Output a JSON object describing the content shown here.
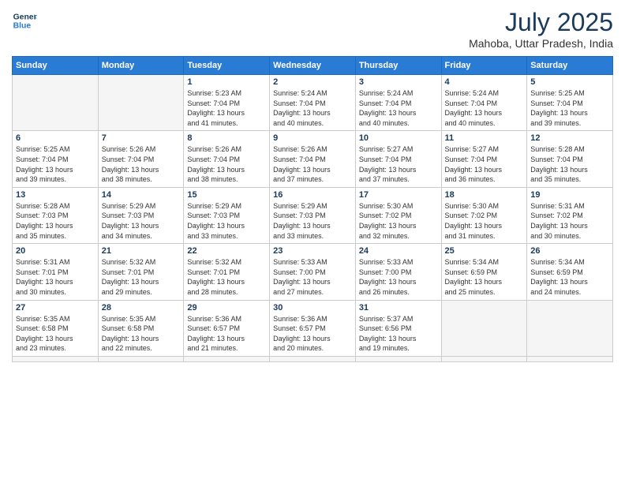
{
  "logo": {
    "line1": "General",
    "line2": "Blue"
  },
  "title": {
    "month_year": "July 2025",
    "location": "Mahoba, Uttar Pradesh, India"
  },
  "weekdays": [
    "Sunday",
    "Monday",
    "Tuesday",
    "Wednesday",
    "Thursday",
    "Friday",
    "Saturday"
  ],
  "days": [
    {
      "num": "",
      "sunrise": "",
      "sunset": "",
      "daylight": ""
    },
    {
      "num": "",
      "sunrise": "",
      "sunset": "",
      "daylight": ""
    },
    {
      "num": "1",
      "sunrise": "Sunrise: 5:23 AM",
      "sunset": "Sunset: 7:04 PM",
      "daylight": "Daylight: 13 hours and 41 minutes."
    },
    {
      "num": "2",
      "sunrise": "Sunrise: 5:24 AM",
      "sunset": "Sunset: 7:04 PM",
      "daylight": "Daylight: 13 hours and 40 minutes."
    },
    {
      "num": "3",
      "sunrise": "Sunrise: 5:24 AM",
      "sunset": "Sunset: 7:04 PM",
      "daylight": "Daylight: 13 hours and 40 minutes."
    },
    {
      "num": "4",
      "sunrise": "Sunrise: 5:24 AM",
      "sunset": "Sunset: 7:04 PM",
      "daylight": "Daylight: 13 hours and 40 minutes."
    },
    {
      "num": "5",
      "sunrise": "Sunrise: 5:25 AM",
      "sunset": "Sunset: 7:04 PM",
      "daylight": "Daylight: 13 hours and 39 minutes."
    },
    {
      "num": "6",
      "sunrise": "Sunrise: 5:25 AM",
      "sunset": "Sunset: 7:04 PM",
      "daylight": "Daylight: 13 hours and 39 minutes."
    },
    {
      "num": "7",
      "sunrise": "Sunrise: 5:26 AM",
      "sunset": "Sunset: 7:04 PM",
      "daylight": "Daylight: 13 hours and 38 minutes."
    },
    {
      "num": "8",
      "sunrise": "Sunrise: 5:26 AM",
      "sunset": "Sunset: 7:04 PM",
      "daylight": "Daylight: 13 hours and 38 minutes."
    },
    {
      "num": "9",
      "sunrise": "Sunrise: 5:26 AM",
      "sunset": "Sunset: 7:04 PM",
      "daylight": "Daylight: 13 hours and 37 minutes."
    },
    {
      "num": "10",
      "sunrise": "Sunrise: 5:27 AM",
      "sunset": "Sunset: 7:04 PM",
      "daylight": "Daylight: 13 hours and 37 minutes."
    },
    {
      "num": "11",
      "sunrise": "Sunrise: 5:27 AM",
      "sunset": "Sunset: 7:04 PM",
      "daylight": "Daylight: 13 hours and 36 minutes."
    },
    {
      "num": "12",
      "sunrise": "Sunrise: 5:28 AM",
      "sunset": "Sunset: 7:04 PM",
      "daylight": "Daylight: 13 hours and 35 minutes."
    },
    {
      "num": "13",
      "sunrise": "Sunrise: 5:28 AM",
      "sunset": "Sunset: 7:03 PM",
      "daylight": "Daylight: 13 hours and 35 minutes."
    },
    {
      "num": "14",
      "sunrise": "Sunrise: 5:29 AM",
      "sunset": "Sunset: 7:03 PM",
      "daylight": "Daylight: 13 hours and 34 minutes."
    },
    {
      "num": "15",
      "sunrise": "Sunrise: 5:29 AM",
      "sunset": "Sunset: 7:03 PM",
      "daylight": "Daylight: 13 hours and 33 minutes."
    },
    {
      "num": "16",
      "sunrise": "Sunrise: 5:29 AM",
      "sunset": "Sunset: 7:03 PM",
      "daylight": "Daylight: 13 hours and 33 minutes."
    },
    {
      "num": "17",
      "sunrise": "Sunrise: 5:30 AM",
      "sunset": "Sunset: 7:02 PM",
      "daylight": "Daylight: 13 hours and 32 minutes."
    },
    {
      "num": "18",
      "sunrise": "Sunrise: 5:30 AM",
      "sunset": "Sunset: 7:02 PM",
      "daylight": "Daylight: 13 hours and 31 minutes."
    },
    {
      "num": "19",
      "sunrise": "Sunrise: 5:31 AM",
      "sunset": "Sunset: 7:02 PM",
      "daylight": "Daylight: 13 hours and 30 minutes."
    },
    {
      "num": "20",
      "sunrise": "Sunrise: 5:31 AM",
      "sunset": "Sunset: 7:01 PM",
      "daylight": "Daylight: 13 hours and 30 minutes."
    },
    {
      "num": "21",
      "sunrise": "Sunrise: 5:32 AM",
      "sunset": "Sunset: 7:01 PM",
      "daylight": "Daylight: 13 hours and 29 minutes."
    },
    {
      "num": "22",
      "sunrise": "Sunrise: 5:32 AM",
      "sunset": "Sunset: 7:01 PM",
      "daylight": "Daylight: 13 hours and 28 minutes."
    },
    {
      "num": "23",
      "sunrise": "Sunrise: 5:33 AM",
      "sunset": "Sunset: 7:00 PM",
      "daylight": "Daylight: 13 hours and 27 minutes."
    },
    {
      "num": "24",
      "sunrise": "Sunrise: 5:33 AM",
      "sunset": "Sunset: 7:00 PM",
      "daylight": "Daylight: 13 hours and 26 minutes."
    },
    {
      "num": "25",
      "sunrise": "Sunrise: 5:34 AM",
      "sunset": "Sunset: 6:59 PM",
      "daylight": "Daylight: 13 hours and 25 minutes."
    },
    {
      "num": "26",
      "sunrise": "Sunrise: 5:34 AM",
      "sunset": "Sunset: 6:59 PM",
      "daylight": "Daylight: 13 hours and 24 minutes."
    },
    {
      "num": "27",
      "sunrise": "Sunrise: 5:35 AM",
      "sunset": "Sunset: 6:58 PM",
      "daylight": "Daylight: 13 hours and 23 minutes."
    },
    {
      "num": "28",
      "sunrise": "Sunrise: 5:35 AM",
      "sunset": "Sunset: 6:58 PM",
      "daylight": "Daylight: 13 hours and 22 minutes."
    },
    {
      "num": "29",
      "sunrise": "Sunrise: 5:36 AM",
      "sunset": "Sunset: 6:57 PM",
      "daylight": "Daylight: 13 hours and 21 minutes."
    },
    {
      "num": "30",
      "sunrise": "Sunrise: 5:36 AM",
      "sunset": "Sunset: 6:57 PM",
      "daylight": "Daylight: 13 hours and 20 minutes."
    },
    {
      "num": "31",
      "sunrise": "Sunrise: 5:37 AM",
      "sunset": "Sunset: 6:56 PM",
      "daylight": "Daylight: 13 hours and 19 minutes."
    },
    {
      "num": "",
      "sunrise": "",
      "sunset": "",
      "daylight": ""
    },
    {
      "num": "",
      "sunrise": "",
      "sunset": "",
      "daylight": ""
    },
    {
      "num": "",
      "sunrise": "",
      "sunset": "",
      "daylight": ""
    }
  ]
}
